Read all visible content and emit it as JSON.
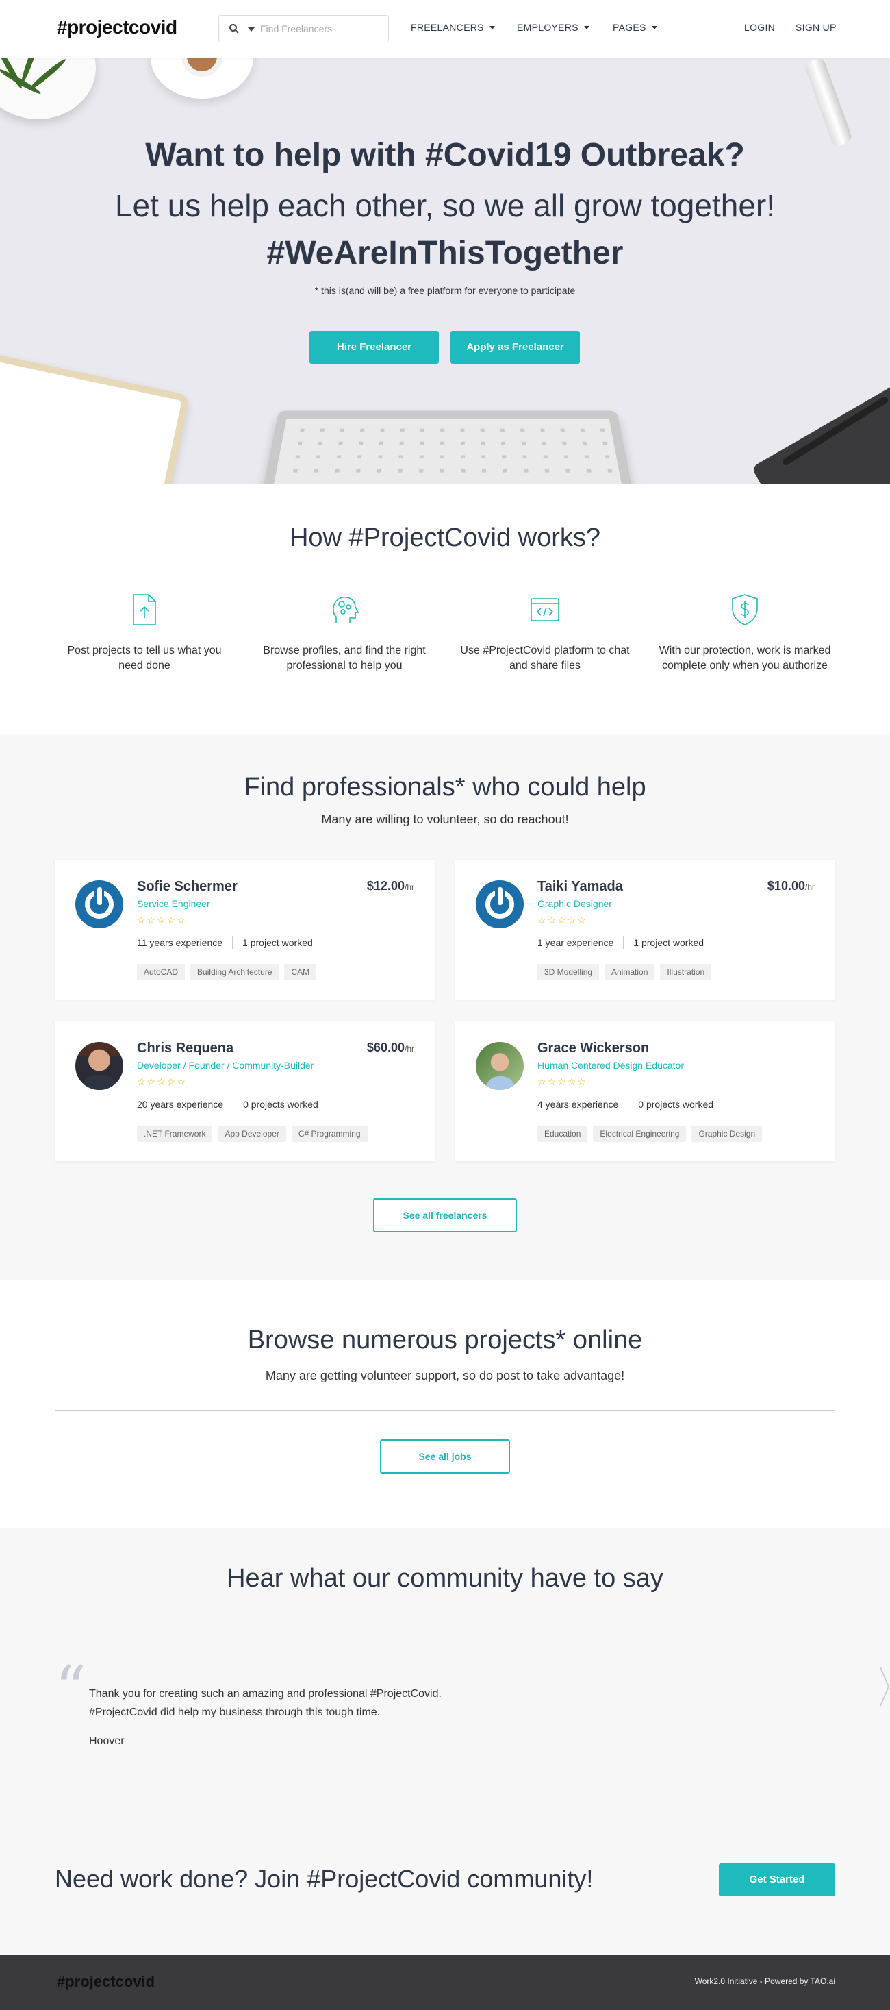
{
  "header": {
    "logo": "#projectcovid",
    "search_placeholder": "Find Freelancers",
    "nav": [
      "FREELANCERS",
      "EMPLOYERS",
      "PAGES"
    ],
    "login": "LOGIN",
    "signup": "SIGN UP"
  },
  "hero": {
    "title": "Want to help with #Covid19 Outbreak?",
    "subtitle": "Let us help each other, so we all grow together!",
    "hashtag": "#WeAreInThisTogether",
    "note": "* this is(and will be) a free platform for everyone to participate",
    "hire_button": "Hire Freelancer",
    "apply_button": "Apply as Freelancer"
  },
  "how": {
    "title": "How #ProjectCovid works?",
    "steps": [
      {
        "icon": "upload-file-icon",
        "text": "Post projects to tell us what you need done"
      },
      {
        "icon": "head-gears-icon",
        "text": "Browse profiles, and find the right professional to help you"
      },
      {
        "icon": "code-window-icon",
        "text": "Use #ProjectCovid platform to chat and share files"
      },
      {
        "icon": "shield-dollar-icon",
        "text": "With our protection, work is marked complete only when you authorize"
      }
    ]
  },
  "professionals": {
    "title": "Find professionals* who could help",
    "subtitle": "Many are willing to volunteer, so do reachout!",
    "per_hour": "/hr",
    "stars": "☆☆☆☆☆",
    "cards": [
      {
        "name": "Sofie Schermer",
        "role": "Service Engineer",
        "rate": "$12.00",
        "experience": "11 years experience",
        "worked": "1 project worked",
        "tags": [
          "AutoCAD",
          "Building Architecture",
          "CAM"
        ]
      },
      {
        "name": "Taiki Yamada",
        "role": "Graphic Designer",
        "rate": "$10.00",
        "experience": "1 year experience",
        "worked": "1 project worked",
        "tags": [
          "3D Modelling",
          "Animation",
          "Illustration"
        ]
      },
      {
        "name": "Chris Requena",
        "role": "Developer / Founder / Community-Builder",
        "rate": "$60.00",
        "experience": "20 years experience",
        "worked": "0 projects worked",
        "tags": [
          ".NET Framework",
          "App Developer",
          "C# Programming"
        ]
      },
      {
        "name": "Grace Wickerson",
        "role": "Human Centered Design Educator",
        "rate": "",
        "experience": "4 years experience",
        "worked": "0 projects worked",
        "tags": [
          "Education",
          "Electrical Engineering",
          "Graphic Design"
        ]
      }
    ],
    "see_all": "See all freelancers"
  },
  "projects": {
    "title": "Browse numerous projects* online",
    "subtitle": "Many are getting volunteer support, so do post to take advantage!",
    "see_all": "See all jobs"
  },
  "testimonials": {
    "title": "Hear what our community have to say",
    "quote_line1": "Thank you for creating such an amazing and professional #ProjectCovid.",
    "quote_line2": "#ProjectCovid did help my business through this tough time.",
    "author": "Hoover"
  },
  "cta": {
    "title": "Need work done? Join #ProjectCovid community!",
    "button": "Get Started"
  },
  "footer": {
    "logo": "#projectcovid",
    "credits": "Work2.0 Initiative - Powered by TAO.ai"
  },
  "colors": {
    "accent": "#1fbabd",
    "text": "#2d3748",
    "footer_bg": "#3a3a3d"
  }
}
